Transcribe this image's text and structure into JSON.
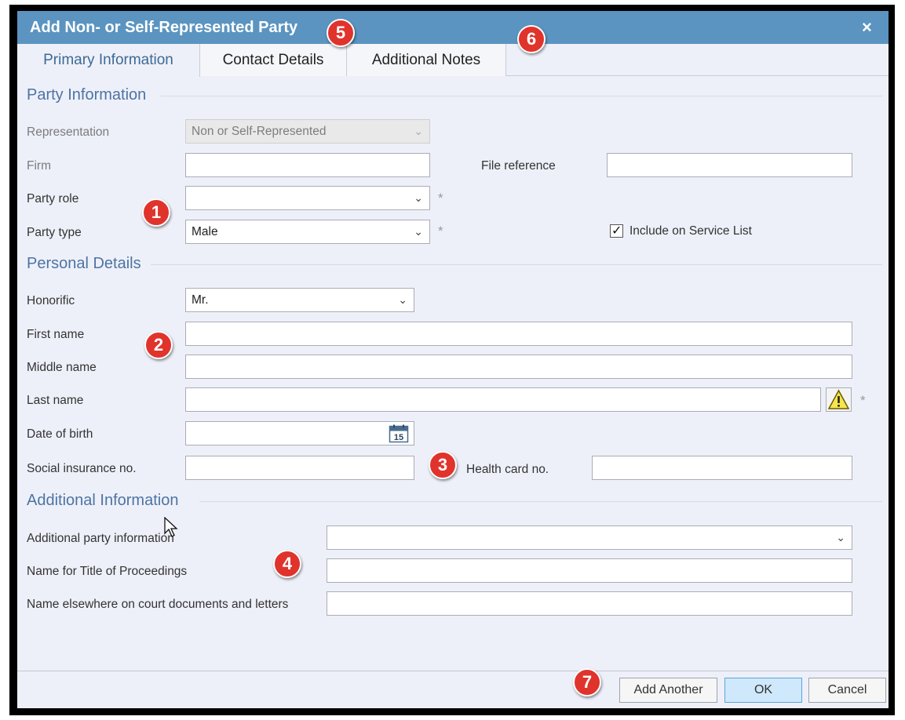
{
  "dialog": {
    "title": "Add Non- or Self-Represented Party",
    "close_symbol": "×"
  },
  "tabs": [
    {
      "label": "Primary Information",
      "active": true
    },
    {
      "label": "Contact Details",
      "active": false
    },
    {
      "label": "Additional Notes",
      "active": false
    }
  ],
  "party_information": {
    "heading": "Party Information",
    "representation": {
      "label": "Representation",
      "value": "Non or Self-Represented"
    },
    "firm": {
      "label": "Firm",
      "value": ""
    },
    "file_reference": {
      "label": "File reference",
      "value": ""
    },
    "party_role": {
      "label": "Party role",
      "value": ""
    },
    "party_type": {
      "label": "Party type",
      "value": "Male"
    },
    "include_service_list": {
      "label": "Include on Service List",
      "checked": true
    }
  },
  "personal_details": {
    "heading": "Personal Details",
    "honorific": {
      "label": "Honorific",
      "value": "Mr."
    },
    "first_name": {
      "label": "First name",
      "value": ""
    },
    "middle_name": {
      "label": "Middle name",
      "value": ""
    },
    "last_name": {
      "label": "Last name",
      "value": ""
    },
    "date_of_birth": {
      "label": "Date of birth",
      "value": "",
      "calendar_day": "15"
    },
    "social_insurance": {
      "label": "Social insurance no.",
      "value": ""
    },
    "health_card": {
      "label": "Health card no.",
      "value": ""
    }
  },
  "additional_information": {
    "heading": "Additional Information",
    "additional_party_info": {
      "label": "Additional party information",
      "value": ""
    },
    "title_of_proceedings": {
      "label": "Name for Title of Proceedings",
      "value": ""
    },
    "elsewhere_name": {
      "label": "Name elsewhere on court documents and letters",
      "value": ""
    }
  },
  "required_marker": "*",
  "chevron": "⌄",
  "check_mark": "✓",
  "badges": [
    "1",
    "2",
    "3",
    "4",
    "5",
    "6",
    "7"
  ],
  "footer": {
    "add_another": "Add Another",
    "ok": "OK",
    "cancel": "Cancel"
  },
  "colors": {
    "titlebar": "#5b94c0",
    "dialog_bg": "#eef0f9",
    "section_heading": "#4d74a3",
    "badge": "#e0332c",
    "ok_button": "#cfe8fb"
  },
  "icons": [
    "close-icon",
    "chevron-down-icon",
    "checkmark-icon",
    "warning-icon",
    "calendar-icon",
    "mouse-pointer-icon"
  ]
}
